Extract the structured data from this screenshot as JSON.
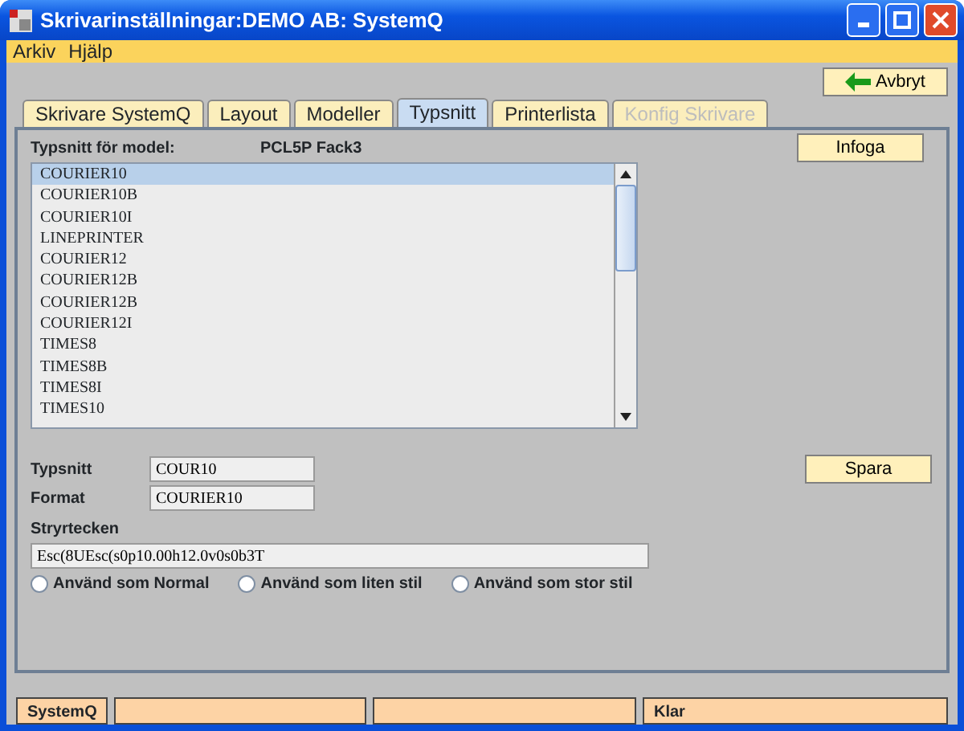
{
  "window": {
    "title": "Skrivarinställningar:DEMO AB: SystemQ"
  },
  "menu": [
    "Arkiv",
    "Hjälp"
  ],
  "toolbar": {
    "cancel_button": "Avbryt"
  },
  "tabs": [
    {
      "label": "Skrivare SystemQ",
      "selected": false,
      "disabled": false
    },
    {
      "label": "Layout",
      "selected": false,
      "disabled": false
    },
    {
      "label": "Modeller",
      "selected": false,
      "disabled": false
    },
    {
      "label": "Typsnitt",
      "selected": true,
      "disabled": false
    },
    {
      "label": "Printerlista",
      "selected": false,
      "disabled": false
    },
    {
      "label": "Konfig Skrivare",
      "selected": false,
      "disabled": true
    }
  ],
  "model": {
    "label": "Typsnitt för model:",
    "value": "PCL5P Fack3"
  },
  "insert_button": "Infoga",
  "fonts": [
    {
      "name": "COURIER10",
      "selected": true
    },
    {
      "name": "COURIER10B",
      "selected": false
    },
    {
      "name": "COURIER10I",
      "selected": false
    },
    {
      "name": "LINEPRINTER",
      "selected": false
    },
    {
      "name": "COURIER12",
      "selected": false
    },
    {
      "name": "COURIER12B",
      "selected": false
    },
    {
      "name": "COURIER12B",
      "selected": false
    },
    {
      "name": "COURIER12I",
      "selected": false
    },
    {
      "name": "TIMES8",
      "selected": false
    },
    {
      "name": "TIMES8B",
      "selected": false
    },
    {
      "name": "TIMES8I",
      "selected": false
    },
    {
      "name": "TIMES10",
      "selected": false
    }
  ],
  "form": {
    "typsnitt_label": "Typsnitt",
    "typsnitt_value": "COUR10",
    "format_label": "Format",
    "format_value": "COURIER10",
    "control_label": "Stryrtecken",
    "control_value": "Esc(8UEsc(s0p10.00h12.0v0s0b3T"
  },
  "save_button": "Spara",
  "radios": [
    {
      "label": "Använd som Normal",
      "selected": false
    },
    {
      "label": "Använd som liten stil",
      "selected": false
    },
    {
      "label": "Använd som stor stil",
      "selected": false
    }
  ],
  "status_bar": {
    "left": "SystemQ",
    "right": "Klar"
  }
}
